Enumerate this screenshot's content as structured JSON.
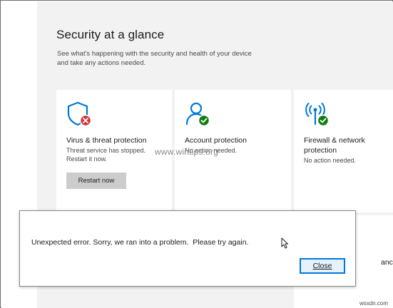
{
  "page": {
    "title": "Security at a glance",
    "description": "See what's happening with the security and health of your device and take any actions needed."
  },
  "tiles": [
    {
      "icon": "shield-error-icon",
      "title": "Virus & threat protection",
      "status_line1": "Threat service has stopped.",
      "status_line2": "Restart it now.",
      "button_label": "Restart now"
    },
    {
      "icon": "account-ok-icon",
      "title": "Account protection",
      "status": "No action needed."
    },
    {
      "icon": "firewall-ok-icon",
      "title": "Firewall & network protection",
      "status": "No action needed."
    }
  ],
  "partial_tile": {
    "text": "ance &"
  },
  "watermark": "www.wintips.org",
  "dialog": {
    "message": "Unexpected error. Sorry, we ran into a problem.  Please try again.",
    "close_label": "Close"
  },
  "site_credit": "wsxdn.com",
  "colors": {
    "accent": "#0078d7",
    "error": "#d13438",
    "ok": "#107c10",
    "background": "#f2f2f2",
    "tile": "#ffffff"
  }
}
